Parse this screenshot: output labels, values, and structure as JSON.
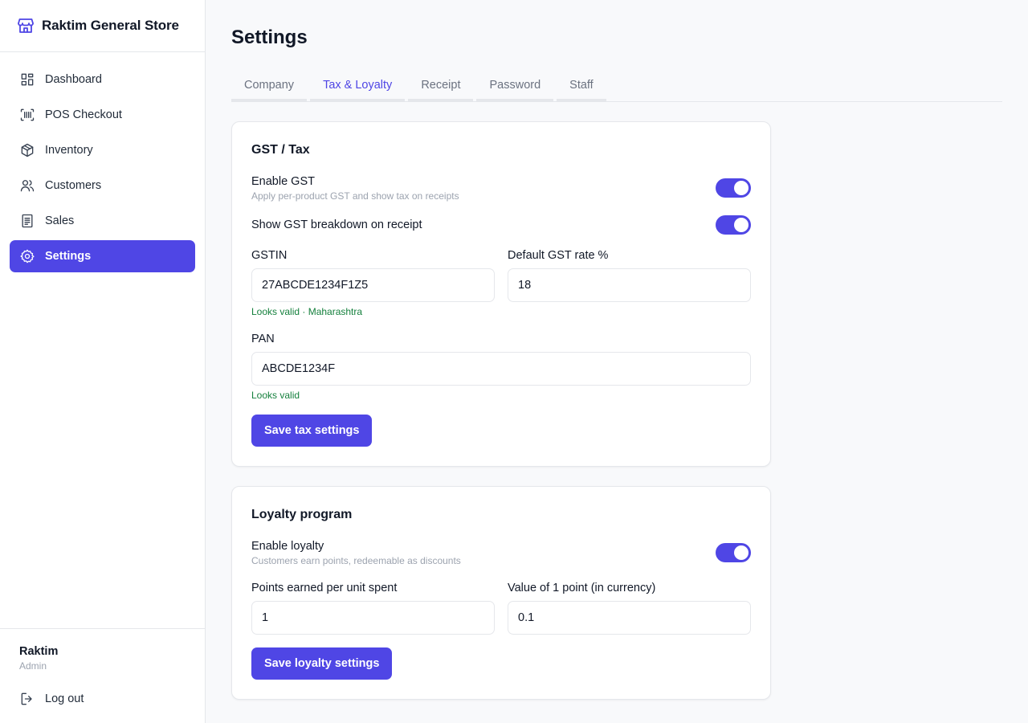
{
  "brand": {
    "name": "Raktim General Store",
    "icon": "store-icon"
  },
  "sidebar": {
    "items": [
      {
        "label": "Dashboard",
        "icon": "dashboard-icon",
        "active": false
      },
      {
        "label": "POS Checkout",
        "icon": "barcode-icon",
        "active": false
      },
      {
        "label": "Inventory",
        "icon": "box-icon",
        "active": false
      },
      {
        "label": "Customers",
        "icon": "users-icon",
        "active": false
      },
      {
        "label": "Sales",
        "icon": "receipt-icon",
        "active": false
      },
      {
        "label": "Settings",
        "icon": "gear-icon",
        "active": true
      }
    ],
    "user": {
      "name": "Raktim",
      "role": "Admin"
    },
    "logout_label": "Log out"
  },
  "page": {
    "title": "Settings"
  },
  "tabs": [
    {
      "label": "Company",
      "active": false
    },
    {
      "label": "Tax & Loyalty",
      "active": true
    },
    {
      "label": "Receipt",
      "active": false
    },
    {
      "label": "Password",
      "active": false
    },
    {
      "label": "Staff",
      "active": false
    }
  ],
  "gst": {
    "title": "GST / Tax",
    "enable": {
      "label": "Enable GST",
      "help": "Apply per-product GST and show tax on receipts",
      "on": true
    },
    "breakdown": {
      "label": "Show GST breakdown on receipt",
      "on": true
    },
    "gstin": {
      "label": "GSTIN",
      "value": "27ABCDE1234F1Z5",
      "validation": "Looks valid · Maharashtra"
    },
    "rate": {
      "label": "Default GST rate %",
      "value": "18"
    },
    "pan": {
      "label": "PAN",
      "value": "ABCDE1234F",
      "validation": "Looks valid"
    },
    "save_label": "Save tax settings"
  },
  "loyalty": {
    "title": "Loyalty program",
    "enable": {
      "label": "Enable loyalty",
      "help": "Customers earn points, redeemable as discounts",
      "on": true
    },
    "points": {
      "label": "Points earned per unit spent",
      "value": "1"
    },
    "point_value": {
      "label": "Value of 1 point (in currency)",
      "value": "0.1"
    },
    "save_label": "Save loyalty settings"
  },
  "colors": {
    "accent": "#4f46e5",
    "valid": "#15803d",
    "border": "#e5e7eb"
  }
}
